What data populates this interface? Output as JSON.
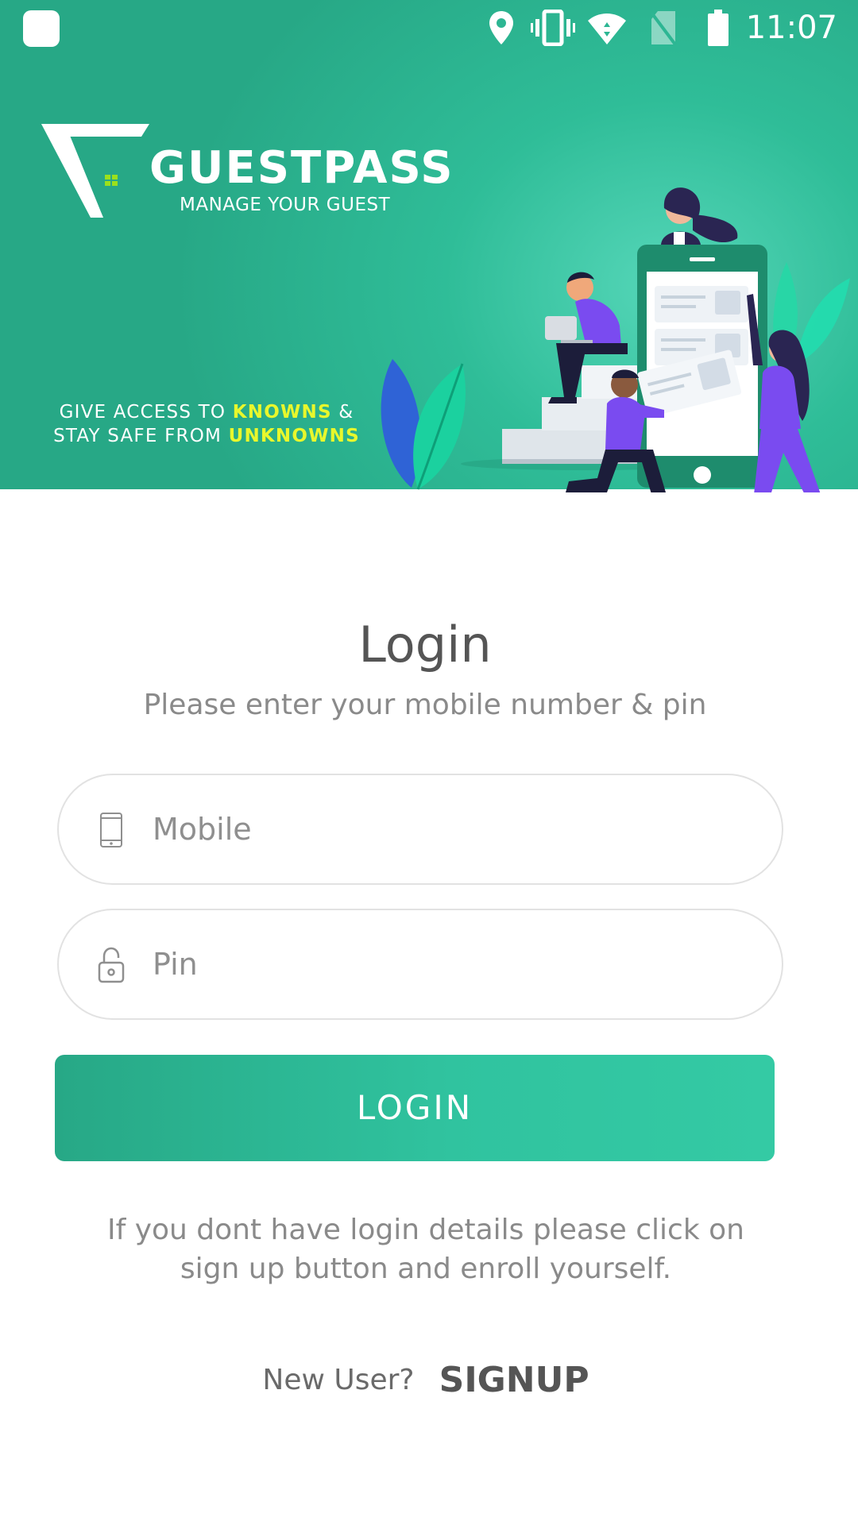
{
  "status_bar": {
    "time": "11:07",
    "icons": [
      "app-notification-icon",
      "location-icon",
      "vibrate-icon",
      "wifi-icon",
      "no-sim-icon",
      "battery-icon"
    ]
  },
  "brand": {
    "name": "GUESTPASS",
    "tagline": "MANAGE YOUR GUEST",
    "logo_icon": "guestpass-logo-icon"
  },
  "slogan": {
    "line1_prefix": "GIVE ACCESS TO ",
    "line1_highlight": "KNOWNS",
    "line1_suffix": " &",
    "line2_prefix": "STAY SAFE FROM ",
    "line2_highlight": "UNKNOWNS"
  },
  "login": {
    "title": "Login",
    "subtitle": "Please enter your mobile number & pin",
    "mobile": {
      "placeholder": "Mobile",
      "value": "",
      "icon": "phone-icon"
    },
    "pin": {
      "placeholder": "Pin",
      "value": "",
      "icon": "lock-icon"
    },
    "button_label": "LOGIN",
    "help_text": "If you dont have login details please click on sign up button and enroll yourself.",
    "new_user_label": "New User?",
    "signup_label": "SIGNUP"
  },
  "colors": {
    "primary": "#2fbd98",
    "primary_dark": "#27a886",
    "highlight": "#e8f72c",
    "text_dark": "#555555",
    "text_muted": "#8a8a8a",
    "field_border": "#e2e2e2"
  }
}
